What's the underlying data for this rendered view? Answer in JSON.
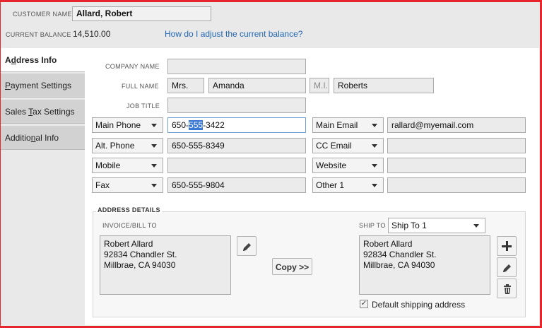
{
  "header": {
    "customer_name_label": "CUSTOMER NAME",
    "customer_name": "Allard, Robert",
    "balance_label": "CURRENT BALANCE",
    "balance_value": "14,510.00",
    "adjust_link": "How do I adjust the current balance?"
  },
  "tabs": [
    {
      "label_pre": "A",
      "label_u": "d",
      "label_post": "dress Info"
    },
    {
      "label_pre": "",
      "label_u": "P",
      "label_post": "ayment Settings"
    },
    {
      "label_pre": "Sales ",
      "label_u": "T",
      "label_post": "ax Settings"
    },
    {
      "label_pre": "Additio",
      "label_u": "n",
      "label_post": "al Info"
    }
  ],
  "form": {
    "company_label": "COMPANY NAME",
    "company_value": "",
    "fullname_label": "FULL NAME",
    "title_value": "Mrs.",
    "first_value": "Amanda",
    "mi_placeholder": "M.I.",
    "last_value": "Roberts",
    "jobtitle_label": "JOB TITLE",
    "jobtitle_value": ""
  },
  "phones": [
    {
      "type": "Main Phone",
      "value_pre": "650-",
      "value_sel": "555",
      "value_post": "-3422"
    },
    {
      "type": "Alt. Phone",
      "value": "650-555-8349"
    },
    {
      "type": "Mobile",
      "value": ""
    },
    {
      "type": "Fax",
      "value": "650-555-9804"
    }
  ],
  "contacts": [
    {
      "type": "Main Email",
      "value": "rallard@myemail.com"
    },
    {
      "type": "CC Email",
      "value": ""
    },
    {
      "type": "Website",
      "value": ""
    },
    {
      "type": "Other 1",
      "value": ""
    }
  ],
  "address": {
    "section_label": "ADDRESS DETAILS",
    "bill_label": "INVOICE/BILL TO",
    "bill_lines": [
      "Robert Allard",
      "92834 Chandler St.",
      "Millbrae, CA 94030"
    ],
    "copy_label": "Copy >>",
    "ship_label": "SHIP TO",
    "ship_select": "Ship To 1",
    "ship_lines": [
      "Robert Allard",
      "92834 Chandler St.",
      "Millbrae, CA 94030"
    ],
    "default_label": "Default shipping address",
    "default_checked": "✓"
  }
}
